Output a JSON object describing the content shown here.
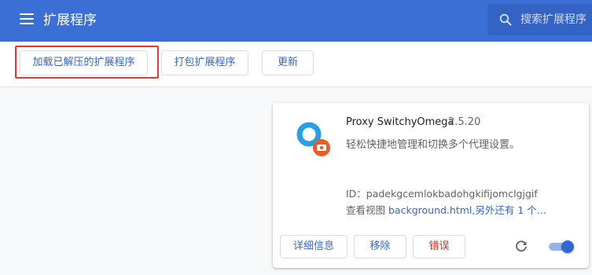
{
  "header": {
    "title": "扩展程序",
    "menu_icon": "hamburger-menu-icon",
    "search_icon": "search-icon",
    "search_placeholder": "搜索扩展程序"
  },
  "toolbar": {
    "load_unpacked_label": "加载已解压的扩展程序",
    "pack_label": "打包扩展程序",
    "update_label": "更新"
  },
  "extension": {
    "name": "Proxy SwitchyOmega",
    "version": "2.5.20",
    "description": "轻松快捷地管理和切换多个代理设置。",
    "id_text": "ID：padekgcemlokbadohgkifijomclgjgif",
    "inspect_prefix": "查看视图",
    "inspect_link": "background.html",
    "inspect_suffix": ",另外还有 1 个…",
    "details_label": "详细信息",
    "remove_label": "移除",
    "errors_label": "错误",
    "reload_icon": "reload-icon",
    "enabled": true
  },
  "colors": {
    "header_bg": "#3b6fd6",
    "accent": "#3367d6",
    "error": "#d93025",
    "highlight_border": "#e53935",
    "icon_blue": "#27a0e8",
    "icon_orange": "#f05a22"
  }
}
